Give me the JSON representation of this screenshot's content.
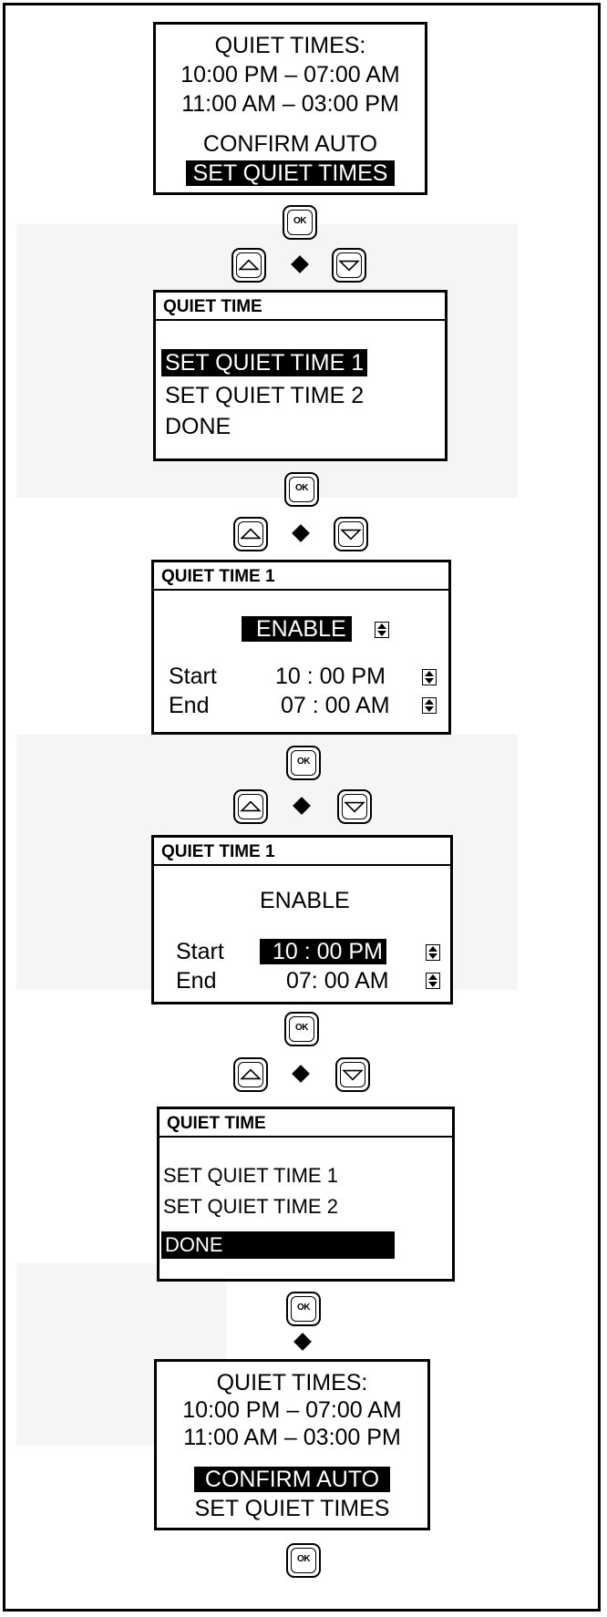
{
  "screens": {
    "summary_top": {
      "title": "QUIET TIMES:",
      "time1": "10:00 PM – 07:00 AM",
      "time2": "11:00 AM – 03:00 PM",
      "option_confirm": "CONFIRM AUTO",
      "option_set": "SET QUIET TIMES"
    },
    "menu_1": {
      "header": "QUIET TIME",
      "item1": "SET QUIET TIME 1",
      "item2": "SET QUIET TIME 2",
      "item3": "DONE"
    },
    "qt1_enable": {
      "header": "QUIET TIME 1",
      "state": "ENABLE",
      "start_label": "Start",
      "start_value": "10 : 00 PM",
      "end_label": "End",
      "end_value": "07 : 00 AM"
    },
    "qt1_start": {
      "header": "QUIET TIME 1",
      "state": "ENABLE",
      "start_label": "Start",
      "start_value": "10 : 00 PM",
      "end_label": "End",
      "end_value": "07: 00 AM"
    },
    "menu_done": {
      "header": "QUIET TIME",
      "item1": "SET QUIET TIME 1",
      "item2": "SET QUIET TIME 2",
      "item3": "DONE"
    },
    "summary_bottom": {
      "title": "QUIET TIMES:",
      "time1": "10:00 PM – 07:00 AM",
      "time2": "11:00 AM – 03:00 PM",
      "option_confirm": "CONFIRM AUTO",
      "option_set": "SET QUIET TIMES"
    }
  },
  "ok_label": "OK"
}
